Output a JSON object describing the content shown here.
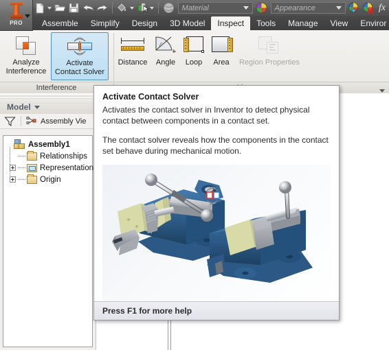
{
  "app": {
    "logo_label": "PRO",
    "logo_icon": "inventor-logo-icon"
  },
  "quick_access": {
    "buttons": [
      {
        "name": "new-document-button",
        "icon": "new-document-icon"
      },
      {
        "name": "open-document-button",
        "icon": "open-folder-icon"
      },
      {
        "name": "save-button",
        "icon": "floppy-save-icon"
      },
      {
        "name": "undo-button",
        "icon": "undo-arrow-icon"
      },
      {
        "name": "redo-button",
        "icon": "redo-arrow-icon"
      },
      {
        "name": "paint-fill-button",
        "icon": "paint-bucket-icon"
      },
      {
        "name": "select-mode-button",
        "icon": "select-cursor-icon"
      },
      {
        "name": "material-sphere-button",
        "icon": "material-sphere-icon"
      },
      {
        "name": "appearance-sphere-button",
        "icon": "appearance-sphere-icon"
      },
      {
        "name": "adjust-appearance-button",
        "icon": "color-dropper-icon"
      },
      {
        "name": "clear-appearance-button",
        "icon": "color-clear-icon"
      },
      {
        "name": "parameters-button",
        "icon": "fx-function-icon"
      }
    ],
    "material_combo": {
      "value": "Material",
      "placeholder": "Material"
    },
    "appearance_combo": {
      "value": "Appearance",
      "placeholder": "Appearance"
    },
    "fx_label": "fx"
  },
  "ribbon": {
    "tabs": [
      {
        "label": "Assemble",
        "active": false
      },
      {
        "label": "Simplify",
        "active": false
      },
      {
        "label": "Design",
        "active": false
      },
      {
        "label": "3D Model",
        "active": false
      },
      {
        "label": "Inspect",
        "active": true
      },
      {
        "label": "Tools",
        "active": false
      },
      {
        "label": "Manage",
        "active": false
      },
      {
        "label": "View",
        "active": false
      },
      {
        "label": "Enviror",
        "active": false
      }
    ],
    "panels": [
      {
        "name": "interference",
        "label": "Interference",
        "buttons": [
          {
            "name": "analyze-interference-button",
            "icon": "interference-overlap-icon",
            "line1": "Analyze",
            "line2": "Interference",
            "selected": false,
            "enabled": true
          },
          {
            "name": "activate-contact-solver-button",
            "icon": "contact-solver-icon",
            "line1": "Activate",
            "line2": "Contact Solver",
            "selected": true,
            "enabled": true
          }
        ]
      },
      {
        "name": "measure",
        "label": "Measure",
        "buttons": [
          {
            "name": "distance-button",
            "icon": "distance-ruler-icon",
            "line1": "Distance",
            "line2": "",
            "selected": false,
            "enabled": true
          },
          {
            "name": "angle-button",
            "icon": "angle-protractor-icon",
            "line1": "Angle",
            "line2": "",
            "selected": false,
            "enabled": true
          },
          {
            "name": "loop-button",
            "icon": "loop-perimeter-icon",
            "line1": "Loop",
            "line2": "",
            "selected": false,
            "enabled": true
          },
          {
            "name": "area-button",
            "icon": "area-surface-icon",
            "line1": "Area",
            "line2": "",
            "selected": false,
            "enabled": true
          },
          {
            "name": "region-properties-button",
            "icon": "region-properties-icon",
            "line1": "Region Properties",
            "line2": "",
            "selected": false,
            "enabled": false
          }
        ]
      }
    ]
  },
  "browser": {
    "title": "Model",
    "title_icon": "chevron-down-icon",
    "filter_icon": "funnel-filter-icon",
    "view_icon": "assembly-view-icon",
    "view_label": "Assembly Vie",
    "tree": [
      {
        "name": "assembly-root",
        "label": "Assembly1",
        "icon": "assembly-icon",
        "bold": true,
        "expander": "none",
        "indent": 0
      },
      {
        "name": "relationships-node",
        "label": "Relationships",
        "icon": "folder-icon",
        "bold": false,
        "expander": "none",
        "indent": 1
      },
      {
        "name": "representations-node",
        "label": "Representations",
        "icon": "representations-folder-icon",
        "bold": false,
        "expander": "plus",
        "indent": 1
      },
      {
        "name": "origin-node",
        "label": "Origin",
        "icon": "folder-icon",
        "bold": false,
        "expander": "plus",
        "indent": 1
      }
    ]
  },
  "tooltip": {
    "title": "Activate Contact Solver",
    "paragraph_1": "Activates the contact solver in Inventor to detect physical contact between components in a contact set.",
    "paragraph_2": "The contact solver reveals how the components in the contact set behave during mechanical motion.",
    "image_alt": "Two blue machine vise assemblies in isometric view with a contact-set marker between them",
    "footer": "Press F1 for more help"
  },
  "colors": {
    "accent_selected": "#4b8fc4",
    "selected_fill": "#bddff3",
    "ribbon_bg": "#f4f3f1",
    "toolbar_bg": "#5d5d5d",
    "tab_strip_bg": "#3d3d3d",
    "tooltip_bg": "#ffffff",
    "tooltip_footer_bg": "#e7e7ee",
    "vise_blue": "#2d5c8f",
    "vise_blue_dark": "#1f4369",
    "jaw_green": "#d8dba8",
    "metal_gray": "#b9bcc0",
    "marker_red": "#e03028",
    "marker_blue": "#2a7fd4",
    "folder_yellow": "#e8c87d",
    "logo_orange": "#d4551c"
  }
}
